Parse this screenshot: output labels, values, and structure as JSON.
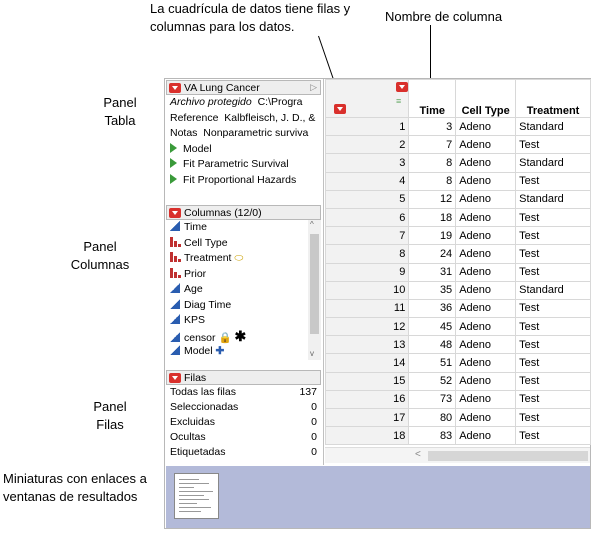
{
  "callouts": {
    "grid_note_line1": "La cuadrícula de datos tiene filas y",
    "grid_note_line2": "columnas para los datos.",
    "column_name": "Nombre de columna",
    "table_panel_line1": "Panel",
    "table_panel_line2": "Tabla",
    "columns_panel_line1": "Panel",
    "columns_panel_line2": "Columnas",
    "rows_panel_line1": "Panel",
    "rows_panel_line2": "Filas",
    "thumbs_line1": "Miniaturas con enlaces a",
    "thumbs_line2": "ventanas de resultados"
  },
  "table_panel": {
    "title": "VA Lung Cancer",
    "archivo_label": "Archivo protegido",
    "archivo_value": "C:\\Progra",
    "reference_label": "Reference",
    "reference_value": "Kalbfleisch, J. D., &",
    "notas_label": "Notas",
    "notas_value": "Nonparametric surviva",
    "scripts": [
      "Model",
      "Fit Parametric Survival",
      "Fit Proportional Hazards"
    ]
  },
  "columns_panel": {
    "title": "Columnas (12/0)",
    "columns": [
      {
        "name": "Time",
        "type": "continuous"
      },
      {
        "name": "Cell Type",
        "type": "nominal"
      },
      {
        "name": "Treatment",
        "type": "nominal"
      },
      {
        "name": "Prior",
        "type": "nominal"
      },
      {
        "name": "Age",
        "type": "continuous"
      },
      {
        "name": "Diag Time",
        "type": "continuous"
      },
      {
        "name": "KPS",
        "type": "continuous"
      },
      {
        "name": "censor",
        "type": "continuous"
      },
      {
        "name": "Model",
        "type": "continuous"
      }
    ]
  },
  "rows_panel": {
    "title": "Filas",
    "stats": [
      {
        "label": "Todas las filas",
        "value": "137"
      },
      {
        "label": "Seleccionadas",
        "value": "0"
      },
      {
        "label": "Excluidas",
        "value": "0"
      },
      {
        "label": "Ocultas",
        "value": "0"
      },
      {
        "label": "Etiquetadas",
        "value": "0"
      }
    ]
  },
  "grid": {
    "headers": [
      "Time",
      "Cell Type",
      "Treatment"
    ],
    "rows": [
      [
        "1",
        "3",
        "Adeno",
        "Standard"
      ],
      [
        "2",
        "7",
        "Adeno",
        "Test"
      ],
      [
        "3",
        "8",
        "Adeno",
        "Standard"
      ],
      [
        "4",
        "8",
        "Adeno",
        "Test"
      ],
      [
        "5",
        "12",
        "Adeno",
        "Standard"
      ],
      [
        "6",
        "18",
        "Adeno",
        "Test"
      ],
      [
        "7",
        "19",
        "Adeno",
        "Test"
      ],
      [
        "8",
        "24",
        "Adeno",
        "Test"
      ],
      [
        "9",
        "31",
        "Adeno",
        "Test"
      ],
      [
        "10",
        "35",
        "Adeno",
        "Standard"
      ],
      [
        "11",
        "36",
        "Adeno",
        "Test"
      ],
      [
        "12",
        "45",
        "Adeno",
        "Test"
      ],
      [
        "13",
        "48",
        "Adeno",
        "Test"
      ],
      [
        "14",
        "51",
        "Adeno",
        "Test"
      ],
      [
        "15",
        "52",
        "Adeno",
        "Test"
      ],
      [
        "16",
        "73",
        "Adeno",
        "Test"
      ],
      [
        "17",
        "80",
        "Adeno",
        "Test"
      ],
      [
        "18",
        "83",
        "Adeno",
        "Test"
      ]
    ]
  },
  "colors": {
    "accent_red": "#d9302c",
    "thumb_bg": "#b3bad9",
    "continuous_blue": "#2a5db0",
    "nominal_red": "#c03030",
    "script_green": "#3a9a3a"
  }
}
